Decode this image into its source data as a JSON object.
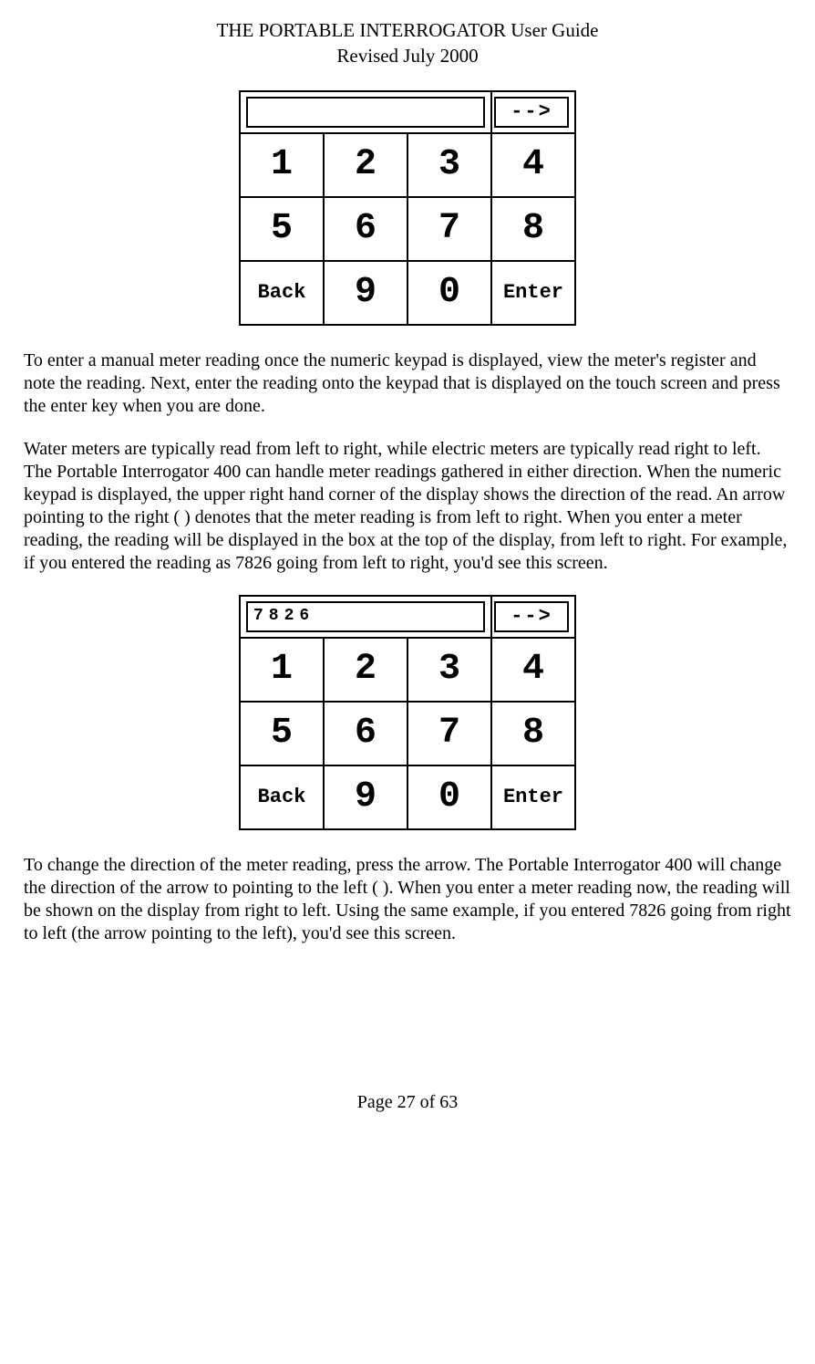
{
  "header": {
    "title": "THE PORTABLE INTERROGATOR User Guide",
    "subtitle": "Revised July 2000"
  },
  "keypad1": {
    "display": "",
    "arrow": "-->",
    "keys": {
      "k1": "1",
      "k2": "2",
      "k3": "3",
      "k4": "4",
      "k5": "5",
      "k6": "6",
      "k7": "7",
      "k8": "8",
      "back": "Back",
      "k9": "9",
      "k0": "0",
      "enter": "Enter"
    }
  },
  "para1": "To enter a manual meter reading once the numeric keypad is displayed, view the meter's register and note the reading.  Next, enter the reading onto the keypad that is displayed on the touch screen and press the enter key when you are done.",
  "para2": "Water meters are typically read from left to right, while electric meters are typically read right to left.  The Portable Interrogator 400 can handle meter readings gathered in either direction.  When the numeric keypad is displayed, the upper right hand corner of the display shows the direction of the read.  An arrow pointing to the right (  ) denotes that the meter reading is from left to right.  When you enter a meter reading, the reading will be displayed in the box at the top of the display, from left to right.  For example, if you entered the reading as 7826 going from left to right, you'd see this screen.",
  "keypad2": {
    "display": "7826",
    "arrow": "-->",
    "keys": {
      "k1": "1",
      "k2": "2",
      "k3": "3",
      "k4": "4",
      "k5": "5",
      "k6": "6",
      "k7": "7",
      "k8": "8",
      "back": "Back",
      "k9": "9",
      "k0": "0",
      "enter": "Enter"
    }
  },
  "para3": "To change the direction of the meter reading, press the arrow.  The Portable Interrogator 400 will change the direction of the arrow to pointing to the left (  ).  When you enter a meter reading now, the reading will be shown on the display from right to left.  Using the same example, if you entered 7826 going from right to left (the arrow pointing to the left), you'd see this screen.",
  "footer": "Page 27 of 63"
}
